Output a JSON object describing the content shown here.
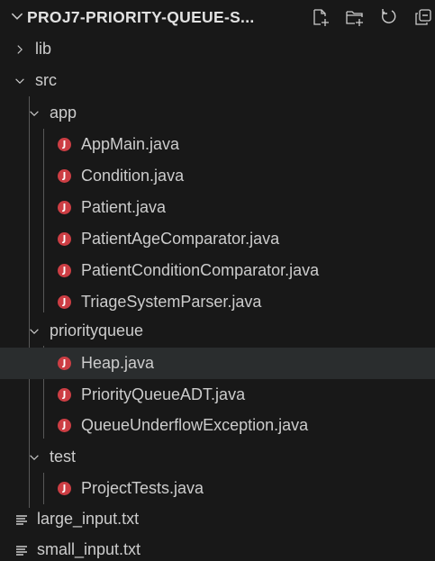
{
  "explorer": {
    "section_title": "PROJ7-PRIORITY-QUEUE-S...",
    "actions": [
      {
        "name": "new-file-icon"
      },
      {
        "name": "new-folder-icon"
      },
      {
        "name": "refresh-icon"
      },
      {
        "name": "collapse-all-icon"
      }
    ],
    "tree": {
      "lib": "lib",
      "src": "src",
      "app": "app",
      "app_files": [
        "AppMain.java",
        "Condition.java",
        "Patient.java",
        "PatientAgeComparator.java",
        "PatientConditionComparator.java",
        "TriageSystemParser.java"
      ],
      "priorityqueue": "priorityqueue",
      "priorityqueue_files": [
        "Heap.java",
        "PriorityQueueADT.java",
        "QueueUnderflowException.java"
      ],
      "test": "test",
      "test_files": [
        "ProjectTests.java"
      ],
      "root_files": [
        "large_input.txt",
        "small_input.txt"
      ],
      "java_icon_letter": "J"
    },
    "colors": {
      "background": "#181818",
      "hover_row": "#2a2d2e",
      "java_icon": "#cc3e44",
      "text": "#cccccc"
    }
  }
}
